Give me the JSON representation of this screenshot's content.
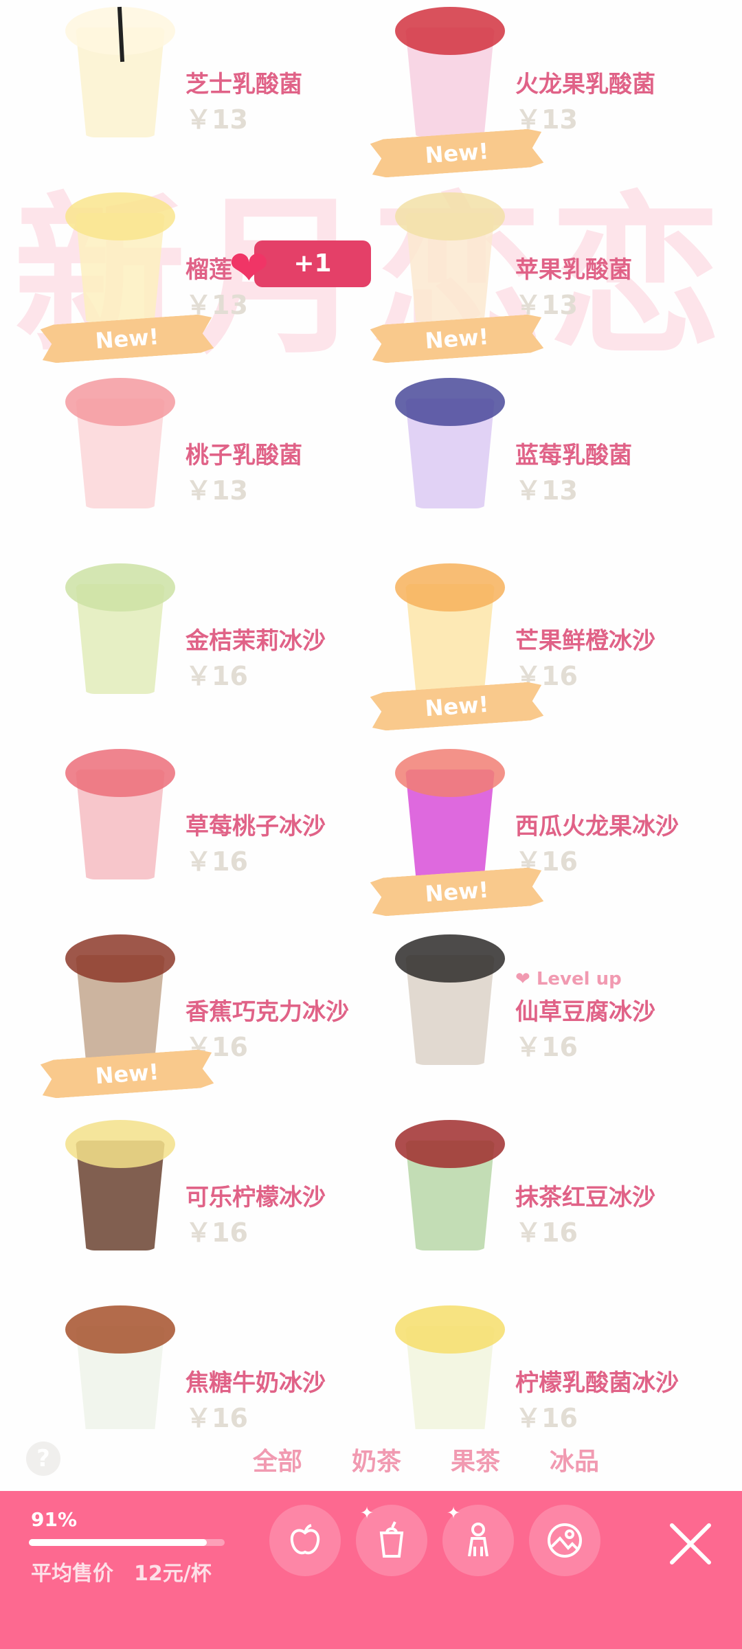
{
  "watermark": "新月恋恋",
  "products": [
    {
      "name": "芝士乳酸菌",
      "price": "￥13",
      "cup": "#fbf2cf",
      "top": "#fff7df"
    },
    {
      "name": "火龙果乳酸菌",
      "price": "￥13",
      "cup": "#f7cfe0",
      "top": "#d2333f"
    },
    {
      "name": "榴莲",
      "price": "￥13",
      "cup": "#fdf0c0",
      "top": "#f9e58d"
    },
    {
      "name": "苹果乳酸菌",
      "price": "￥13",
      "cup": "#fbe9d0",
      "top": "#f2e1a7"
    },
    {
      "name": "桃子乳酸菌",
      "price": "￥13",
      "cup": "#fcd6d8",
      "top": "#f49aa0"
    },
    {
      "name": "蓝莓乳酸菌",
      "price": "￥13",
      "cup": "#dccaf3",
      "top": "#4a4a9a"
    },
    {
      "name": "金桔茉莉冰沙",
      "price": "￥16",
      "cup": "#e2ecba",
      "top": "#cde2a5"
    },
    {
      "name": "芒果鲜橙冰沙",
      "price": "￥16",
      "cup": "#fde5a8",
      "top": "#f7b15c"
    },
    {
      "name": "草莓桃子冰沙",
      "price": "￥16",
      "cup": "#f6bcc2",
      "top": "#ec6e7a"
    },
    {
      "name": "西瓜火龙果冰沙",
      "price": "￥16",
      "cup": "#d84fd8",
      "top": "#f17f74"
    },
    {
      "name": "香蕉巧克力冰沙",
      "price": "￥16",
      "cup": "#c3a78e",
      "top": "#8d3a2a"
    },
    {
      "name": "仙草豆腐冰沙",
      "price": "￥16",
      "cup": "#dcd2c8",
      "top": "#2e2b2a"
    },
    {
      "name": "可乐柠檬冰沙",
      "price": "￥16",
      "cup": "#6b4331",
      "top": "#f3e08a"
    },
    {
      "name": "抹茶红豆冰沙",
      "price": "￥16",
      "cup": "#b8d7a8",
      "top": "#a02e2e"
    },
    {
      "name": "焦糖牛奶冰沙",
      "price": "￥16",
      "cup": "#eef3ea",
      "top": "#a6512c"
    },
    {
      "name": "柠檬乳酸菌冰沙",
      "price": "￥16",
      "cup": "#f1f5dd",
      "top": "#f6de6b"
    }
  ],
  "ribbon_text": "New!",
  "level_up": "Level up",
  "plus_one": "+1",
  "filters": {
    "all": "全部",
    "milk_tea": "奶茶",
    "fruit_tea": "果茶",
    "ice": "冰品"
  },
  "stats": {
    "percent": "91%",
    "percent_value": 0.91,
    "avg_label": "平均售价",
    "avg_value": "12元/杯"
  },
  "colors": {
    "accent": "#fd6990",
    "name": "#e06287",
    "price": "#e2ddd4",
    "ribbon": "#f9c98c"
  }
}
